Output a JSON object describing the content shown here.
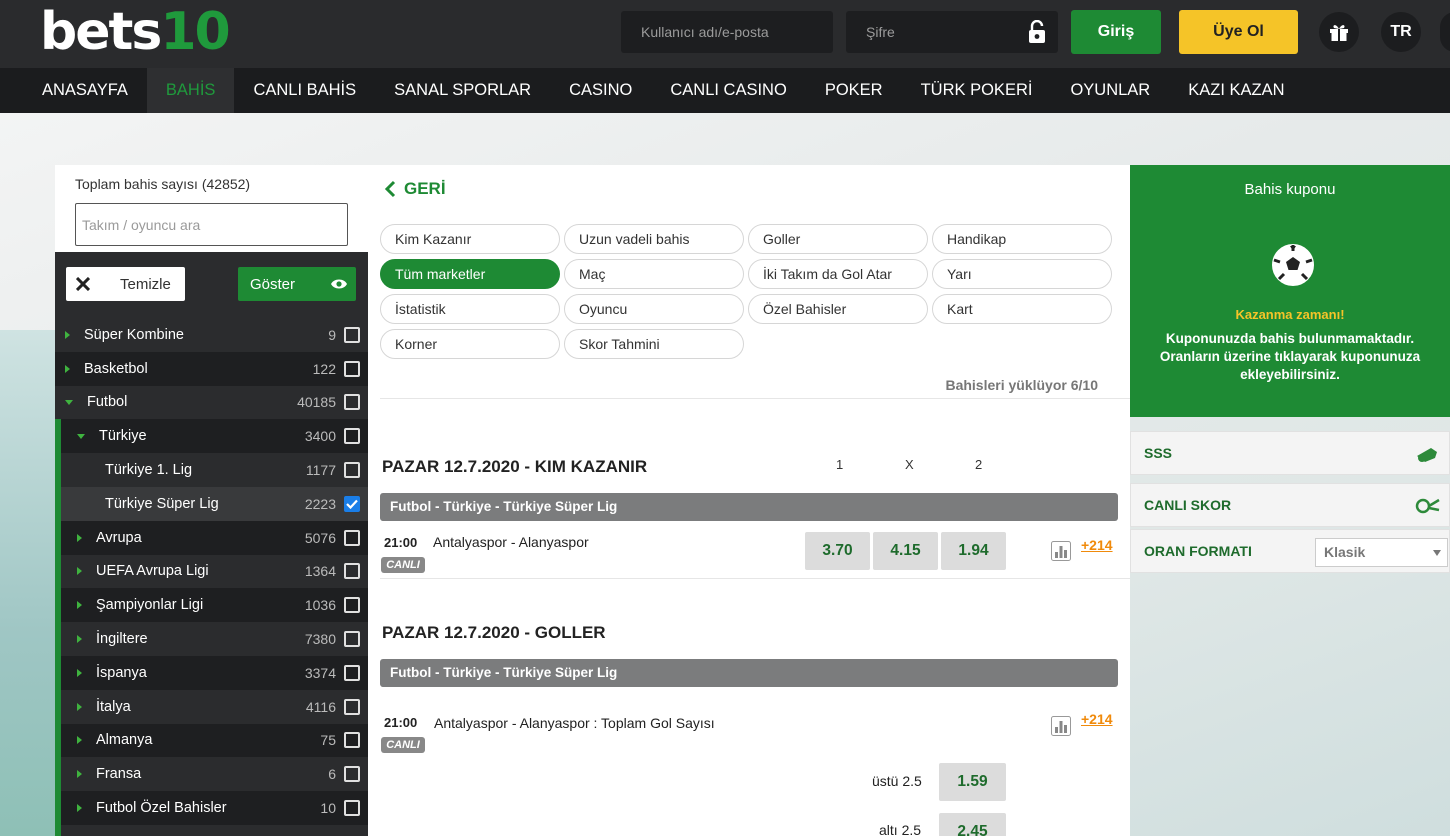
{
  "header": {
    "logo_text_white": "bets",
    "logo_text_green": "10",
    "username_placeholder": "Kullanıcı adı/e-posta",
    "password_placeholder": "Şifre",
    "login_label": "Giriş",
    "register_label": "Üye Ol",
    "language": "TR"
  },
  "nav": {
    "items": [
      {
        "label": "ANASAYFA",
        "active": false
      },
      {
        "label": "BAHİS",
        "active": true
      },
      {
        "label": "CANLI BAHİS",
        "active": false
      },
      {
        "label": "SANAL SPORLAR",
        "active": false
      },
      {
        "label": "CASINO",
        "active": false
      },
      {
        "label": "CANLI CASINO",
        "active": false
      },
      {
        "label": "POKER",
        "active": false
      },
      {
        "label": "TÜRK POKERİ",
        "active": false
      },
      {
        "label": "OYUNLAR",
        "active": false
      },
      {
        "label": "KAZI KAZAN",
        "active": false
      }
    ]
  },
  "sidebar": {
    "total_label": "Toplam bahis sayısı (42852)",
    "search_placeholder": "Takım / oyuncu ara",
    "clear_label": "Temizle",
    "show_label": "Göster",
    "items": [
      {
        "label": "Süper Kombine",
        "count": "9"
      },
      {
        "label": "Basketbol",
        "count": "122"
      },
      {
        "label": "Futbol",
        "count": "40185"
      },
      {
        "label": "Türkiye",
        "count": "3400"
      },
      {
        "label": "Türkiye 1. Lig",
        "count": "1177"
      },
      {
        "label": "Türkiye Süper Lig",
        "count": "2223"
      },
      {
        "label": "Avrupa",
        "count": "5076"
      },
      {
        "label": "UEFA Avrupa Ligi",
        "count": "1364"
      },
      {
        "label": "Şampiyonlar Ligi",
        "count": "1036"
      },
      {
        "label": "İngiltere",
        "count": "7380"
      },
      {
        "label": "İspanya",
        "count": "3374"
      },
      {
        "label": "İtalya",
        "count": "4116"
      },
      {
        "label": "Almanya",
        "count": "75"
      },
      {
        "label": "Fransa",
        "count": "6"
      },
      {
        "label": "Futbol Özel Bahisler",
        "count": "10"
      }
    ]
  },
  "center": {
    "back_label": "GERİ",
    "chips": [
      "Kim Kazanır",
      "Uzun vadeli bahis",
      "Goller",
      "Handikap",
      "Tüm marketler",
      "Maç",
      "İki Takım da Gol Atar",
      "Yarı",
      "İstatistik",
      "Oyuncu",
      "Özel Bahisler",
      "Kart",
      "Korner",
      "Skor Tahmini"
    ],
    "active_chip": "Tüm marketler",
    "loading": "Bahisleri yüklüyor 6/10",
    "section1": {
      "title": "PAZAR 12.7.2020 - KIM KAZANIR",
      "col1": "1",
      "colx": "X",
      "col2": "2",
      "league": "Futbol - Türkiye - Türkiye Süper Lig",
      "time": "21:00",
      "match": "Antalyaspor - Alanyaspor",
      "live": "CANLI",
      "odd1": "3.70",
      "oddx": "4.15",
      "odd2": "1.94",
      "more": "+214"
    },
    "section2": {
      "title": "PAZAR 12.7.2020 - GOLLER",
      "league": "Futbol - Türkiye - Türkiye Süper Lig",
      "time": "21:00",
      "match": "Antalyaspor - Alanyaspor : Toplam Gol Sayısı",
      "live": "CANLI",
      "more": "+214",
      "over_label": "üstü 2.5",
      "over_odd": "1.59",
      "under_label": "altı 2.5",
      "under_odd": "2.45"
    }
  },
  "coupon": {
    "title": "Bahis kuponu",
    "win_text": "Kazanma zamanı!",
    "message": "Kuponunuzda bahis bulunmamaktadır. Oranların üzerine tıklayarak kuponunuza ekleyebilirsiniz."
  },
  "right": {
    "faq": "SSS",
    "live_score": "CANLI SKOR",
    "odds_format_label": "ORAN FORMATI",
    "odds_format_value": "Klasik"
  },
  "colors": {
    "brand_green": "#1e8a34",
    "accent_yellow": "#f5c428",
    "more_orange": "#f08a0b"
  }
}
